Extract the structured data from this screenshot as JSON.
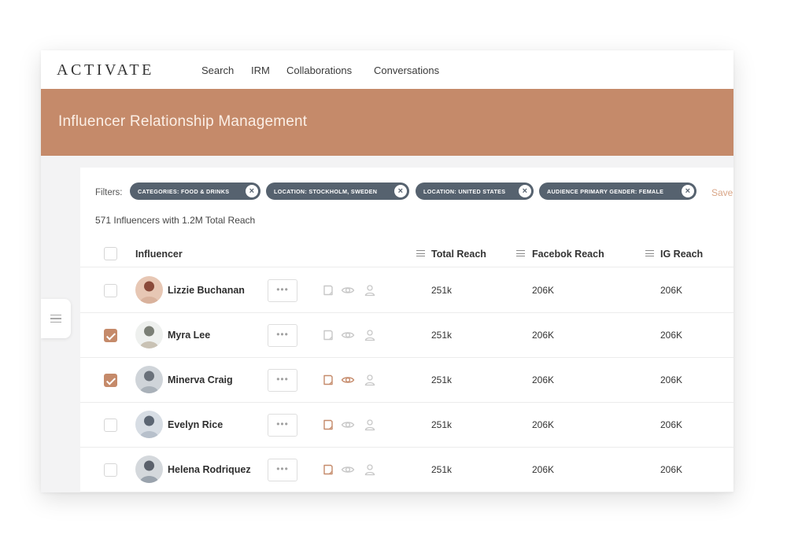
{
  "app": {
    "logo": "ACTIVATE",
    "nav": [
      "Search",
      "IRM",
      "Collaborations",
      "Conversations"
    ]
  },
  "banner": {
    "title": "Influencer Relationship Management"
  },
  "filters": {
    "label": "Filters:",
    "chips": [
      "CATEGORIES: FOOD & DRINKS",
      "LOCATION: STOCKHOLM, SWEDEN",
      "LOCATION: UNITED STATES",
      "AUDIENCE PRIMARY GENDER: FEMALE"
    ],
    "save_label": "Save"
  },
  "summary": "571 Influencers with 1.2M Total Reach",
  "table": {
    "columns": [
      "Influencer",
      "Total Reach",
      "Facebok Reach",
      "IG Reach"
    ],
    "rows": [
      {
        "name": "Lizzie Buchanan",
        "checked": false,
        "total_reach": "251k",
        "facebook_reach": "206K",
        "ig_reach": "206K",
        "active_icons": []
      },
      {
        "name": "Myra Lee",
        "checked": true,
        "total_reach": "251k",
        "facebook_reach": "206K",
        "ig_reach": "206K",
        "active_icons": []
      },
      {
        "name": "Minerva Craig",
        "checked": true,
        "total_reach": "251k",
        "facebook_reach": "206K",
        "ig_reach": "206K",
        "active_icons": [
          "note-icon",
          "eye-icon"
        ]
      },
      {
        "name": "Evelyn Rice",
        "checked": false,
        "total_reach": "251k",
        "facebook_reach": "206K",
        "ig_reach": "206K",
        "active_icons": [
          "note-icon"
        ]
      },
      {
        "name": "Helena Rodriquez",
        "checked": false,
        "total_reach": "251k",
        "facebook_reach": "206K",
        "ig_reach": "206K",
        "active_icons": [
          "note-icon"
        ]
      }
    ],
    "more_label": "•••"
  },
  "icons": {
    "row_actions": [
      "note-icon",
      "eye-icon",
      "user-icon"
    ],
    "sidebar_toggle": "menu-icon",
    "chip_remove": "close-icon"
  },
  "colors": {
    "accent": "#c58a6a",
    "chip_bg": "#56626f",
    "icon_inactive": "#c8c8c8",
    "save_link": "#d9a586"
  }
}
